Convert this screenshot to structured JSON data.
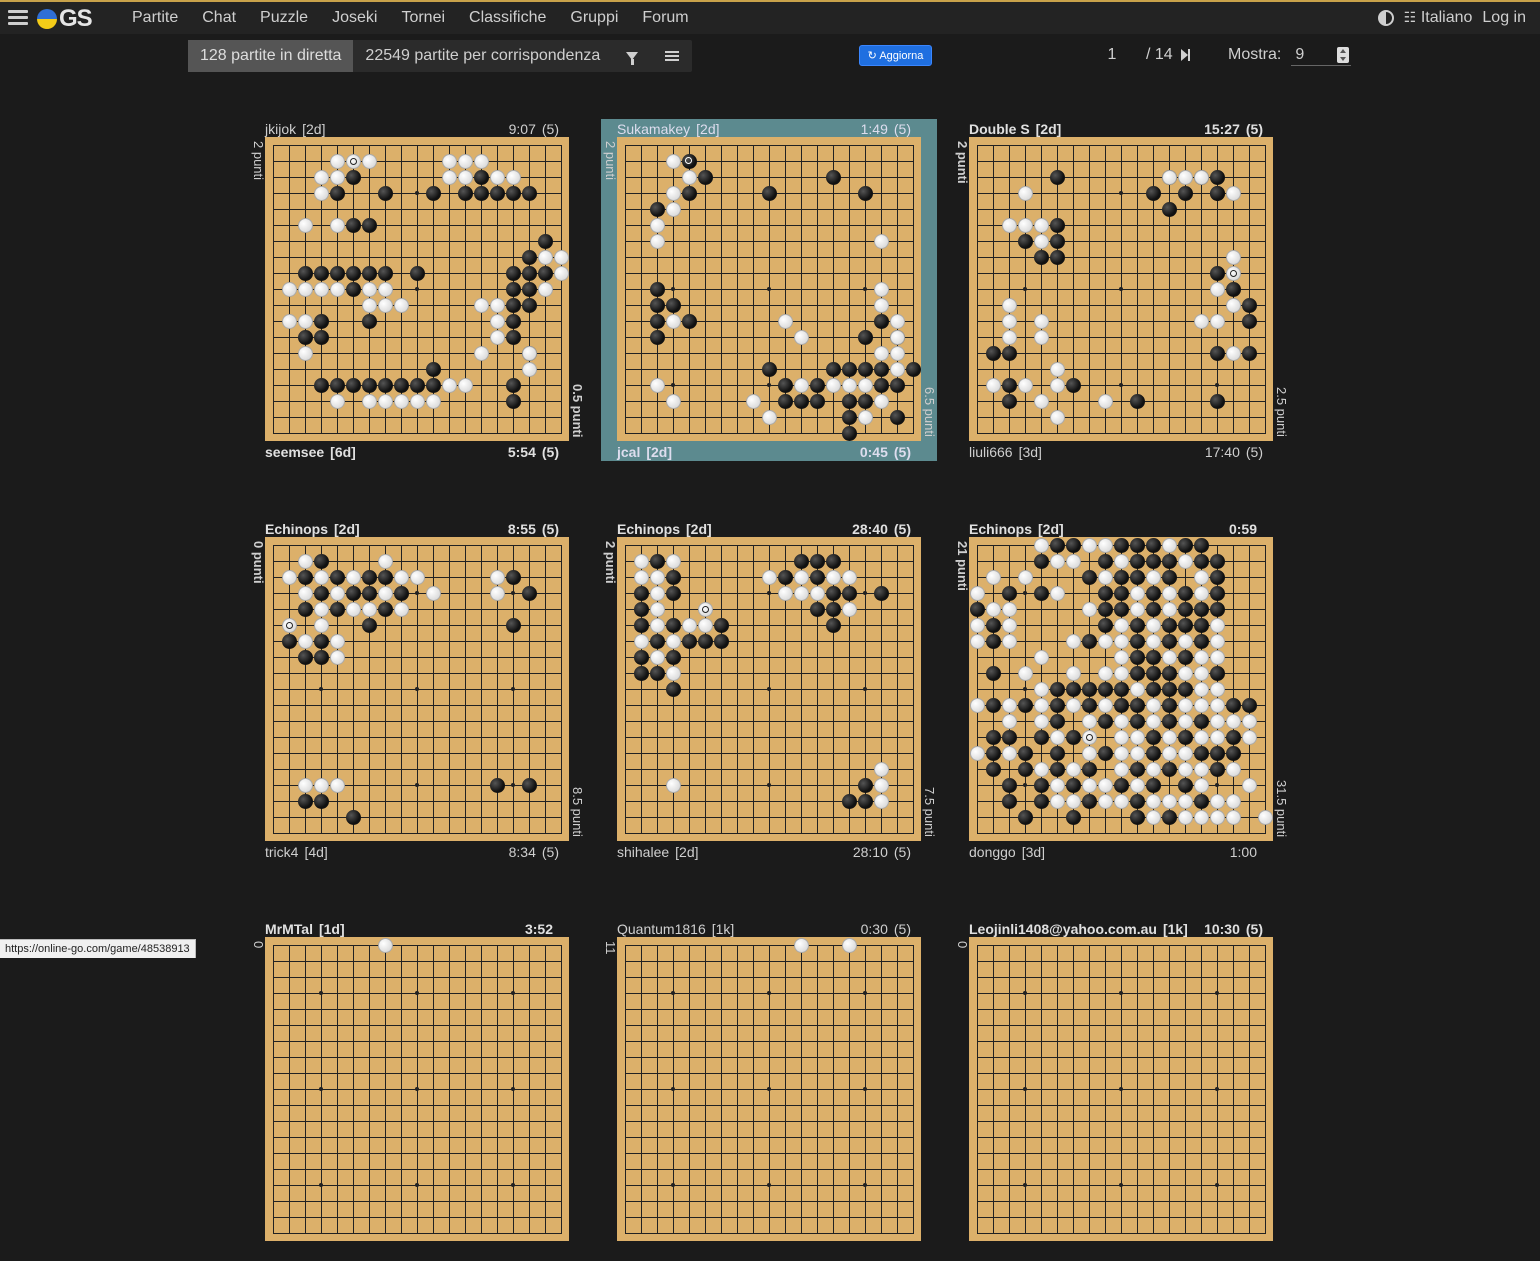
{
  "nav": {
    "logo_text": "GS",
    "items": [
      "Partite",
      "Chat",
      "Puzzle",
      "Joseki",
      "Tornei",
      "Classifiche",
      "Gruppi",
      "Forum"
    ],
    "language": "Italiano",
    "login": "Log in"
  },
  "filters": {
    "live": "128 partite in diretta",
    "correspondence": "22549 partite per corrispondenza"
  },
  "refresh_label": "Aggiorna",
  "pager": {
    "current": "1",
    "total": "/ 14",
    "show_label": "Mostra:",
    "show_value": "9"
  },
  "games": [
    {
      "top": {
        "name": "jkijok",
        "rank": "[2d]",
        "time": "9:07",
        "periods": "(5)",
        "bold": false
      },
      "bottom": {
        "name": "seemsee",
        "rank": "[6d]",
        "time": "5:54",
        "periods": "(5)",
        "bold": true
      },
      "score_left": "2 punti",
      "score_right": "0.5 punti",
      "left_bold": false,
      "right_bold": true,
      "highlight": false,
      "last": [
        1,
        5,
        "w"
      ],
      "black": "2,5 2,13 3,4 3,7 3,10 3,12 3,13 3,14 3,15 3,16 5,5 5,6 6,17 7,16 8,17 8,2 8,3 8,4 8,5 8,6 8,7 8,9 8,15 8,16 9,5 9,15 9,16 10,15 10,16 11,3 11,6 11,15 12,2 12,3 12,15 13,16 14,10 15,3 15,4 15,5 15,6 15,7 15,8 15,9 15,10 15,15 16,15",
      "white": "1,4 1,6 1,11 1,12 1,13 2,3 2,4 2,11 2,12 2,14 2,15 3,3 5,2 5,4 7,17 7,18 8,18 9,1 9,2 9,3 9,4 9,6 9,7 9,17 10,6 10,7 10,8 10,13 10,14 11,1 11,2 11,14 12,14 13,2 13,13 13,16 14,16 15,11 15,12 16,4 16,6 16,7 16,8 16,9 16,10"
    },
    {
      "top": {
        "name": "Sukamakey",
        "rank": "[2d]",
        "time": "1:49",
        "periods": "(5)",
        "bold": false
      },
      "bottom": {
        "name": "jcal",
        "rank": "[2d]",
        "time": "0:45",
        "periods": "(5)",
        "bold": true
      },
      "score_left": "2 punti",
      "score_right": "6.5 punti",
      "left_bold": false,
      "right_bold": false,
      "highlight": true,
      "last": [
        1,
        4,
        "b"
      ],
      "black": "2,5 3,4 3,9 2,13 3,15 4,2 9,2 10,2 10,3 11,2 11,4 12,2 14,9 14,13 14,14 14,15 14,16 14,18 15,10 15,12 15,16 15,17 16,10 16,11 16,12 16,14 16,15 17,14 18,14 17,17 11,16 12,15 12,17",
      "white": "1,3 2,4 3,3 4,3 5,2 6,2 6,16 9,16 10,16 11,3 11,10 11,17 12,11 12,17 13,16 15,11 15,13 15,14 15,15 15,2 16,3 16,8 17,9 17,15 16,16 13,17 14,17"
    },
    {
      "top": {
        "name": "Double S",
        "rank": "[2d]",
        "time": "15:27",
        "periods": "(5)",
        "bold": true
      },
      "bottom": {
        "name": "liuli666",
        "rank": "[3d]",
        "time": "17:40",
        "periods": "(5)",
        "bold": false
      },
      "score_left": "2 punti",
      "score_right": "2.5 punti",
      "left_bold": true,
      "right_bold": false,
      "highlight": false,
      "last": [
        8,
        16,
        "w"
      ],
      "black": "2,5 2,12 2,14 2,15 3,11 3,13 3,15 3,15 4,12 5,5 6,3 6,5 7,4 7,5 8,15 9,16 10,17 11,17 13,1 13,2 13,15 13,17 15,2 15,6 16,2 16,10 16,15",
      "white": "2,12 2,13 2,14 3,16 3,3 5,2 5,3 5,4 6,4 7,16 9,15 10,2 10,16 11,2 11,4 11,14 11,15 12,2 12,4 13,16 14,5 15,1 15,3 15,5 16,4 16,8 17,5",
      "extra": ""
    },
    {
      "top": {
        "name": "Echinops",
        "rank": "[2d]",
        "time": "8:55",
        "periods": "(5)",
        "bold": true
      },
      "bottom": {
        "name": "trick4",
        "rank": "[4d]",
        "time": "8:34",
        "periods": "(5)",
        "bold": false
      },
      "score_left": "0 punti",
      "score_right": "8.5 punti",
      "left_bold": true,
      "right_bold": false,
      "highlight": false,
      "last": [
        5,
        1,
        "w"
      ],
      "black": "1,3 2,2 2,4 2,6 2,7 3,3 3,5 3,6 3,8 4,2 4,4 4,7 5,6 6,1 6,3 7,2 7,3 2,15 3,16 5,15 15,14 15,16 16,2 16,3 17,5",
      "white": "1,2 2,1 2,3 2,5 2,8 2,9 3,2 3,4 3,7 3,10 4,3 4,5 4,6 4,8 5,3 6,2 6,4 7,4 1,7 2,14 3,14 15,2 15,3 15,4"
    },
    {
      "top": {
        "name": "Echinops",
        "rank": "[2d]",
        "time": "28:40",
        "periods": "(5)",
        "bold": true
      },
      "bottom": {
        "name": "shihalee",
        "rank": "[2d]",
        "time": "28:10",
        "periods": "(5)",
        "bold": false
      },
      "score_left": "2 punti",
      "score_right": "7.5 punti",
      "left_bold": true,
      "right_bold": false,
      "highlight": false,
      "last": [
        4,
        5,
        "w"
      ],
      "black": "1,2 2,3 3,1 3,3 4,1 5,1 5,3 6,2 6,4 6,5 6,6 7,1 7,3 8,1 8,2 9,3 5,6 1,11 1,12 1,13 2,10 2,12 3,13 3,14 4,12 4,13 5,13 3,16 15,15 16,14 16,15",
      "white": "1,1 1,3 2,1 2,2 3,2 4,2 5,2 5,4 5,5 6,1 6,3 7,2 8,3 2,9 2,11 2,13 3,10 3,11 3,12 2,14 4,14 14,16 15,16 16,16 15,3"
    },
    {
      "top": {
        "name": "Echinops",
        "rank": "[2d]",
        "time": "0:59",
        "periods": "",
        "bold": true
      },
      "bottom": {
        "name": "donggo",
        "rank": "[3d]",
        "time": "1:00",
        "periods": "",
        "bold": false
      },
      "score_left": "21 punti",
      "score_right": "31.5 punti",
      "left_bold": true,
      "right_bold": false,
      "highlight": false,
      "last": [
        12,
        7,
        "w"
      ],
      "black": "0,5 0,6 0,9 0,10 0,11 0,13 0,14 1,4 1,8 1,10 1,11 1,12 1,14 1,15 2,7 2,9 2,10 2,12 2,15 3,2 3,4 3,8 3,9 3,11 3,13 3,15 4,0 4,8 4,9 4,11 4,13 4,14 4,15 5,1 5,8 5,10 5,12 5,13 5,14 6,1 6,7 6,10 6,12 6,14 7,10 7,11 7,13 8,1 8,10 8,11 8,12 8,15 9,5 9,6 9,7 9,8 9,9 9,11 9,12 9,13 10,1 10,3 10,5 10,7 10,9 10,10 10,12 10,16 10,17 11,5 11,8 11,10 11,12 11,14 12,1 12,2 12,4 12,6 12,11 12,13 12,16 13,1 13,3 13,5 13,8 13,11 13,14 13,15 13,16 14,1 14,3 14,5 14,7 14,10 14,12 14,15 15,2 15,4 15,6 15,9 15,11 15,13 16,2 16,4 16,7 16,10 16,14 17,3 17,6 17,10 17,12",
      "white": "0,4 0,7 0,8 0,12 1,5 1,6 1,9 1,13 2,1 2,3 2,8 2,11 2,14 3,0 3,5 3,10 3,12 3,14 4,1 4,2 4,7 4,10 4,12 5,0 5,2 5,9 5,11 5,15 6,0 6,2 6,6 6,8 6,9 6,11 6,13 6,15 7,4 7,9 7,12 7,14 7,15 8,3 8,6 8,8 8,9 8,13 8,14 9,4 9,10 9,14 9,15 10,0 10,2 10,4 10,6 10,8 10,11 10,13 10,14 10,15 11,2 11,4 11,7 11,9 11,11 11,13 11,15 11,16 11,17 12,5 12,9 12,10 12,12 12,14 12,15 12,17 13,0 13,2 13,7 13,9 13,10 13,12 13,13 14,4 14,6 14,9 14,11 14,13 14,14 14,16 15,5 15,7 15,8 15,10 15,14 15,17 16,5 16,6 16,8 16,9 16,11 16,12 16,13 16,15 16,16 17,11 17,13 17,14 17,15 17,16 17,18"
    },
    {
      "top": {
        "name": "MrMTal",
        "rank": "[1d]",
        "time": "3:52",
        "periods": "",
        "bold": true
      },
      "bottom": {
        "name": "",
        "rank": "",
        "time": "",
        "periods": "",
        "bold": false
      },
      "score_left": "0",
      "score_right": "",
      "left_bold": false,
      "right_bold": false,
      "highlight": false,
      "last": null,
      "black": "",
      "white": "0,7"
    },
    {
      "top": {
        "name": "Quantum1816",
        "rank": "[1k]",
        "time": "0:30",
        "periods": "(5)",
        "bold": false
      },
      "bottom": {
        "name": "",
        "rank": "",
        "time": "",
        "periods": "",
        "bold": false
      },
      "score_left": "11",
      "score_right": "",
      "left_bold": false,
      "right_bold": false,
      "highlight": false,
      "last": null,
      "black": "",
      "white": "0,11 0,14"
    },
    {
      "top": {
        "name": "Leojinli1408@yahoo.com.au",
        "rank": "[1k]",
        "time": "10:30",
        "periods": "(5)",
        "bold": true
      },
      "bottom": {
        "name": "",
        "rank": "",
        "time": "",
        "periods": "",
        "bold": false
      },
      "score_left": "0",
      "score_right": "",
      "left_bold": false,
      "right_bold": false,
      "highlight": false,
      "last": null,
      "black": "",
      "white": ""
    }
  ],
  "status_url": "https://online-go.com/game/48538913"
}
